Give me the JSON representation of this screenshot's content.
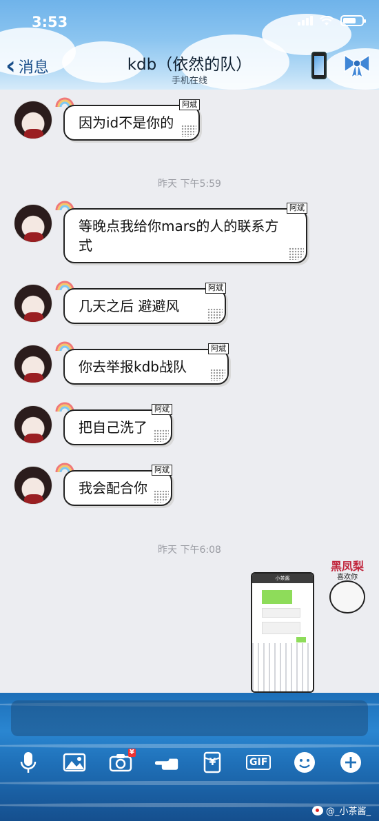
{
  "status_bar": {
    "time": "3:53"
  },
  "header": {
    "back_label": "消息",
    "title": "kdb（依然的队）",
    "subtitle": "手机在线"
  },
  "messages": [
    {
      "text": "因为id不是你的",
      "tag": "阿斌"
    },
    {
      "text": "等晚点我给你mars的人的联系方式",
      "tag": "阿斌"
    },
    {
      "text": "几天之后 避避风",
      "tag": "阿斌"
    },
    {
      "text": "你去举报kdb战队",
      "tag": "阿斌"
    },
    {
      "text": "把自己洗了",
      "tag": "阿斌"
    },
    {
      "text": "我会配合你",
      "tag": "阿斌"
    }
  ],
  "timestamps": [
    "昨天 下午5:59",
    "昨天 下午6:08"
  ],
  "shared_screenshot": {
    "title": "小茶酱"
  },
  "sticker": {
    "title": "黑凤梨",
    "subtitle": "喜欢你"
  },
  "toolbar": {
    "gif_label": "GIF",
    "red_packet_symbol": "¥"
  },
  "watermark": {
    "text": "@_小茶酱_"
  },
  "colors": {
    "sky": "#8cc5f0",
    "ocean": "#2a86d1",
    "chat_bg": "#ecedf1"
  }
}
